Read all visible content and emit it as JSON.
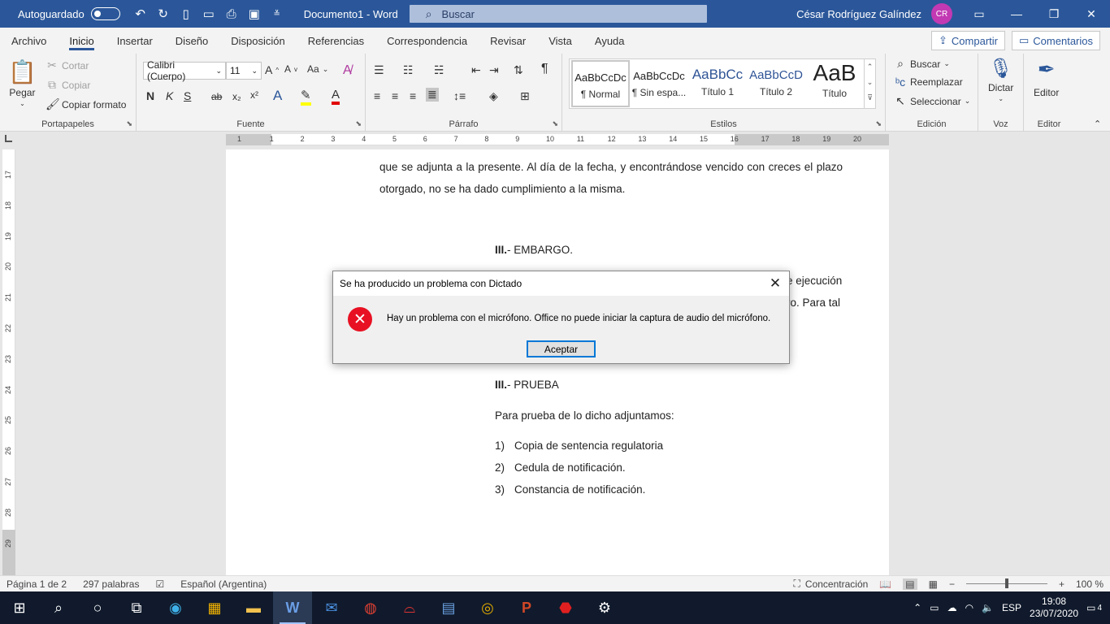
{
  "titlebar": {
    "autosave_label": "Autoguardado",
    "doc_title": "Documento1  -  Word",
    "search_placeholder": "Buscar",
    "user_name": "César Rodríguez Galíndez",
    "user_initials": "CR"
  },
  "tabs": [
    "Archivo",
    "Inicio",
    "Insertar",
    "Diseño",
    "Disposición",
    "Referencias",
    "Correspondencia",
    "Revisar",
    "Vista",
    "Ayuda"
  ],
  "tab_actions": {
    "share": "Compartir",
    "comments": "Comentarios"
  },
  "ribbon": {
    "clipboard": {
      "paste": "Pegar",
      "cut": "Cortar",
      "copy": "Copiar",
      "format_painter": "Copiar formato",
      "label": "Portapapeles"
    },
    "font": {
      "font_name": "Calibri (Cuerpo)",
      "font_size": "11",
      "label": "Fuente",
      "bold": "N",
      "italic": "K",
      "underline": "S",
      "strike": "ab",
      "sub": "x₂",
      "sup": "x²",
      "change_case": "Aa"
    },
    "paragraph": {
      "label": "Párrafo"
    },
    "styles": {
      "label": "Estilos",
      "items": [
        {
          "sample": "AaBbCcDc",
          "name": "¶ Normal"
        },
        {
          "sample": "AaBbCcDc",
          "name": "¶ Sin espa..."
        },
        {
          "sample": "AaBbCc",
          "name": "Título 1"
        },
        {
          "sample": "AaBbCcD",
          "name": "Título 2"
        },
        {
          "sample": "AaB",
          "name": "Título"
        }
      ]
    },
    "editing": {
      "find": "Buscar",
      "replace": "Reemplazar",
      "select": "Seleccionar",
      "label": "Edición"
    },
    "voice": {
      "dictate": "Dictar",
      "label": "Voz"
    },
    "editor": {
      "editor": "Editor",
      "label": "Editor"
    }
  },
  "ruler": {
    "h_ticks": [
      "1",
      "1",
      "2",
      "3",
      "4",
      "5",
      "6",
      "7",
      "8",
      "9",
      "10",
      "11",
      "12",
      "13",
      "14",
      "15",
      "16",
      "17",
      "18",
      "19",
      "20"
    ],
    "v_ticks": [
      "17",
      "18",
      "19",
      "20",
      "21",
      "22",
      "23",
      "24",
      "25",
      "26",
      "27",
      "28",
      "29"
    ]
  },
  "document": {
    "line1": "que se adjunta a la presente. Al día de la fecha, y encontrándose vencido con creces el plazo",
    "line2": "otorgado, no se ha dado cumplimiento a la misma.",
    "heading_embargo_num": "III.",
    "heading_embargo": "- EMBARGO.",
    "partial_right1": "e ejecución",
    "partial_right2": "ro. Para tal",
    "heading_prueba_num": "III.",
    "heading_prueba": "- PRUEBA",
    "prueba_intro": "Para prueba de lo dicho adjuntamos:",
    "list": [
      {
        "num": "1)",
        "text": "Copia de sentencia regulatoria"
      },
      {
        "num": "2)",
        "text": "Cedula de notificación."
      },
      {
        "num": "3)",
        "text": "Constancia de notificación."
      }
    ]
  },
  "dialog": {
    "title": "Se ha producido un problema con Dictado",
    "message": "Hay un problema con el micrófono. Office no puede iniciar la captura de audio del micrófono.",
    "ok_button": "Aceptar"
  },
  "statusbar": {
    "page": "Página 1 de 2",
    "words": "297 palabras",
    "language": "Español (Argentina)",
    "focus": "Concentración",
    "zoom": "100 %"
  },
  "taskbar": {
    "language": "ESP",
    "time": "19:08",
    "date": "23/07/2020",
    "notifications": "4"
  },
  "colors": {
    "word_blue": "#2b579a",
    "error_red": "#e81123",
    "taskbar": "#101a2c"
  }
}
